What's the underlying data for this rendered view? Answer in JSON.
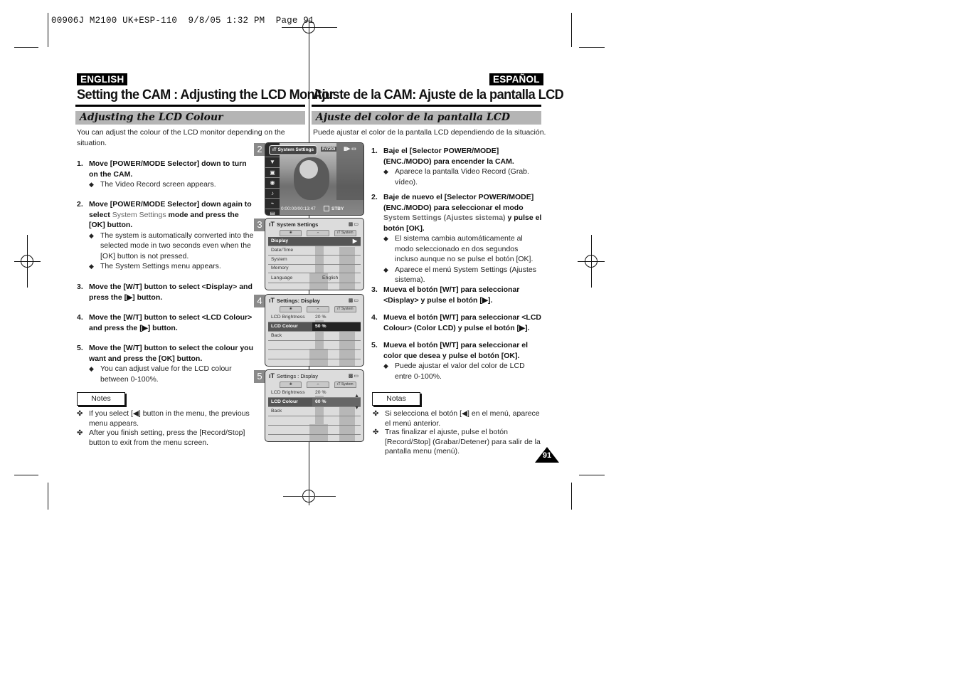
{
  "slug": {
    "text": "00906J M2100 UK+ESP-110  9/8/05 1:32 PM  Page 91"
  },
  "english": {
    "lang_tag": "ENGLISH",
    "title": "Setting the CAM : Adjusting the LCD Monitor",
    "section": "Adjusting the LCD Colour",
    "intro": "You can adjust the colour of the LCD monitor depending on the situation.",
    "steps": [
      {
        "num": "1.",
        "head": "Move [POWER/MODE Selector] down to turn on the CAM.",
        "bullets": [
          "The Video Record screen appears."
        ]
      },
      {
        "num": "2.",
        "head_pre": "Move [POWER/MODE Selector] down again to select ",
        "head_hl": "System Settings",
        "head_post": " mode and press the [OK] button.",
        "bullets": [
          "The system is automatically converted into the selected mode in two seconds even when the [OK] button is not pressed.",
          "The System Settings menu appears."
        ]
      },
      {
        "num": "3.",
        "head": "Move the [W/T] button to select <Display> and press the [▶] button."
      },
      {
        "num": "4.",
        "head": "Move the [W/T] button to select <LCD Colour> and press the [▶] button."
      },
      {
        "num": "5.",
        "head": "Move the [W/T] button to select the colour you want and press the [OK] button.",
        "bullets": [
          "You can adjust value for the LCD colour between 0-100%."
        ]
      }
    ],
    "notes_label": "Notes",
    "notes": [
      "If you select [◀] button in the menu, the previous menu appears.",
      "After you finish setting, press the [Record/Stop] button to exit from the menu screen."
    ]
  },
  "spanish": {
    "lang_tag": "ESPAÑOL",
    "title": "Ajuste de la CAM: Ajuste de la pantalla LCD",
    "section": "Ajuste del color de la pantalla LCD",
    "intro": "Puede ajustar el color de la pantalla LCD dependiendo de la situación.",
    "steps": [
      {
        "num": "1.",
        "head": "Baje el [Selector POWER/MODE] (ENC./MODO) para encender la CAM.",
        "bullets": [
          "Aparece la pantalla Video Record (Grab. vídeo)."
        ]
      },
      {
        "num": "2.",
        "head_pre": "Baje de nuevo el [Selector POWER/MODE] (ENC./MODO) para seleccionar el modo ",
        "head_hl": "System Settings (Ajustes sistema)",
        "head_post": " y pulse el botón [OK].",
        "bullets": [
          "El sistema cambia automáticamente al modo seleccionado en dos segundos incluso aunque no se pulse el botón [OK].",
          "Aparece el menú System Settings (Ajustes sistema)."
        ]
      },
      {
        "num": "3.",
        "head": "Mueva el botón [W/T] para seleccionar <Display> y pulse el botón [▶]."
      },
      {
        "num": "4.",
        "head": "Mueva el botón [W/T] para seleccionar <LCD Colour> (Color LCD) y pulse el botón [▶]."
      },
      {
        "num": "5.",
        "head": "Mueva el botón [W/T] para seleccionar el color que desea y pulse el botón [OK].",
        "bullets": [
          "Puede ajustar el valor del color de LCD entre 0-100%."
        ]
      }
    ],
    "notes_label": "Notas",
    "notes": [
      "Si selecciona el botón [◀] en el menú, aparece el menú anterior.",
      "Tras finalizar el ajuste, pulse el botón [Record/Stop] (Grabar/Detener) para salir de la pantalla menu (menú)."
    ]
  },
  "page_number": "91",
  "note_mark": "✤",
  "screens": [
    {
      "num": "2",
      "pill": "System Settings",
      "res": "F/720i",
      "timecode": "0:00:00/00:13:47",
      "status": "STBY",
      "side_icons": [
        "▼",
        "▣",
        "◉",
        "♪",
        "⌁",
        "▤"
      ]
    },
    {
      "num": "3",
      "head_icon": "ıT",
      "head": "System Settings",
      "tabs": [
        "❀",
        "⌢",
        "ıT System"
      ],
      "rows": [
        {
          "label": "Display",
          "selected": true,
          "arrow": "▶"
        },
        {
          "label": "Date/Time"
        },
        {
          "label": "System"
        },
        {
          "label": "Memory"
        },
        {
          "label": "Language",
          "value": "English"
        }
      ]
    },
    {
      "num": "4",
      "head_icon": "ıT",
      "head": "Settings: Display",
      "tabs": [
        "❀",
        "⌢",
        "ıT System"
      ],
      "rows": [
        {
          "label": "LCD Brightness",
          "value": "20 %"
        },
        {
          "label": "LCD Colour",
          "value": "50 %",
          "selected": true
        },
        {
          "label": "Back"
        }
      ]
    },
    {
      "num": "5",
      "head_icon": "ıT",
      "head": "Settings : Display",
      "tabs": [
        "❀",
        "⌢",
        "ıT System"
      ],
      "rows": [
        {
          "label": "LCD Brightness",
          "value": "20 %"
        },
        {
          "label": "LCD Colour",
          "value": "60 %",
          "selected": true
        },
        {
          "label": "Back"
        }
      ]
    }
  ]
}
